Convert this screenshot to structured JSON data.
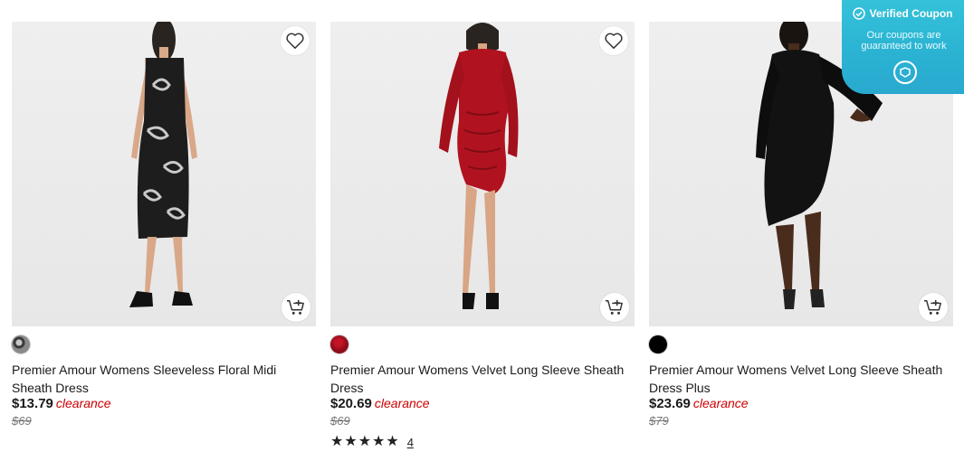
{
  "products": [
    {
      "title": "Premier Amour Womens Sleeveless Floral Midi Sheath Dress",
      "price": "$13.79",
      "price_tag": "clearance",
      "original_price": "$69",
      "swatch_color": "#6b6b6b",
      "dress_color": "#1d1d1d"
    },
    {
      "title": "Premier Amour Womens Velvet Long Sleeve Sheath Dress",
      "price": "$20.69",
      "price_tag": "clearance",
      "original_price": "$69",
      "swatch_color": "#9b0f1f",
      "dress_color": "#b0131f",
      "rating": {
        "stars": "★★★★★",
        "count": "4"
      }
    },
    {
      "title": "Premier Amour Womens Velvet Long Sleeve Sheath Dress Plus",
      "price": "$23.69",
      "price_tag": "clearance",
      "original_price": "$79",
      "swatch_color": "#000000",
      "dress_color": "#121212"
    }
  ],
  "coupon": {
    "heading": "Verified Coupon",
    "text": "Our coupons are guaranteed to work",
    "bg_color": "#2fb8d6"
  },
  "icons": {
    "favorite": "heart-icon",
    "add_to_cart": "cart-plus-icon",
    "verified": "check-circle-icon",
    "coupon_logo": "tag-logo-icon"
  }
}
